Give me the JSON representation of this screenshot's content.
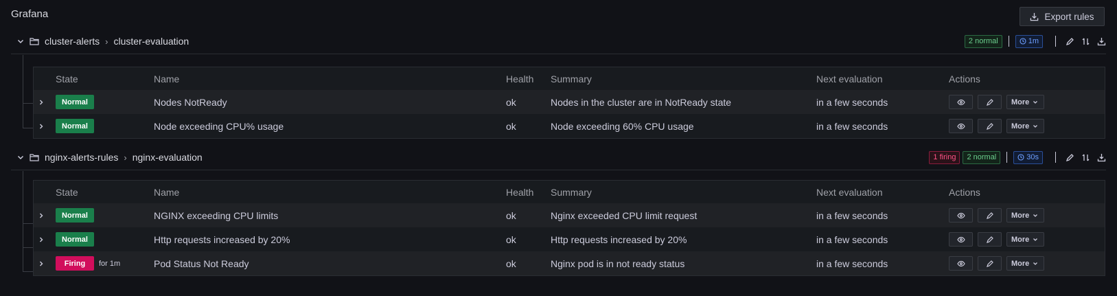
{
  "app": {
    "title": "Grafana"
  },
  "export_button": {
    "label": "Export rules",
    "icon": "download-icon"
  },
  "table_headers": {
    "state": "State",
    "name": "Name",
    "health": "Health",
    "summary": "Summary",
    "next": "Next evaluation",
    "actions": "Actions"
  },
  "groups": [
    {
      "folder": "cluster-alerts",
      "separator": "›",
      "evaluation": "cluster-evaluation",
      "badges": {
        "normal": "2 normal",
        "interval": "1m"
      },
      "rules": [
        {
          "state": "Normal",
          "for": "",
          "name": "Nodes NotReady",
          "health": "ok",
          "summary": "Nodes in the cluster are in NotReady state",
          "next": "in a few seconds",
          "more": "More"
        },
        {
          "state": "Normal",
          "for": "",
          "name": "Node exceeding CPU% usage",
          "health": "ok",
          "summary": "Node exceeding 60% CPU usage",
          "next": "in a few seconds",
          "more": "More"
        }
      ]
    },
    {
      "folder": "nginx-alerts-rules",
      "separator": "›",
      "evaluation": "nginx-evaluation",
      "badges": {
        "firing": "1 firing",
        "normal": "2 normal",
        "interval": "30s"
      },
      "rules": [
        {
          "state": "Normal",
          "for": "",
          "name": "NGINX exceeding CPU limits",
          "health": "ok",
          "summary": "Nginx exceeded CPU limit request",
          "next": "in a few seconds",
          "more": "More"
        },
        {
          "state": "Normal",
          "for": "",
          "name": "Http requests increased by 20%",
          "health": "ok",
          "summary": "Http requests increased by 20%",
          "next": "in a few seconds",
          "more": "More"
        },
        {
          "state": "Firing",
          "for": "for 1m",
          "name": "Pod Status Not Ready",
          "health": "ok",
          "summary": "Nginx pod is in not ready status",
          "next": "in a few seconds",
          "more": "More"
        }
      ]
    }
  ],
  "colors": {
    "normal": "#1a7f4b",
    "firing": "#d10e5c",
    "interval": "#6e9fff",
    "background": "#111217"
  }
}
